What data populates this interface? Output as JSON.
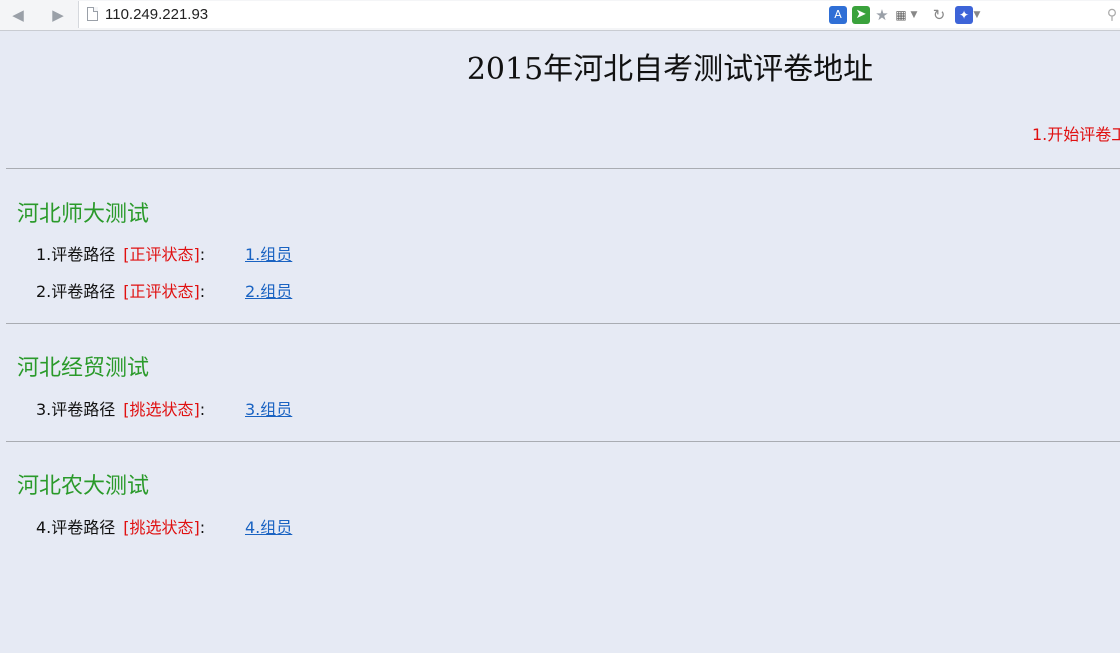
{
  "browser": {
    "url": "110.249.221.93",
    "icons": {
      "back": "back-arrow-icon",
      "forward": "forward-arrow-icon",
      "translate": "translate-icon",
      "send": "send-icon",
      "bookmark": "star-icon",
      "qr": "qr-code-icon",
      "refresh": "refresh-icon",
      "baidu": "paw-icon",
      "search": "search-icon"
    }
  },
  "page": {
    "title": "2015年河北自考测试评卷地址",
    "start_link": "1.开始评卷工",
    "sections": [
      {
        "title": "河北师大测试",
        "rows": [
          {
            "label": "1.评卷路径",
            "status": "[正评状态]",
            "colon": ":",
            "link": "1.组员"
          },
          {
            "label": "2.评卷路径",
            "status": "[正评状态]",
            "colon": ":",
            "link": "2.组员"
          }
        ]
      },
      {
        "title": "河北经贸测试",
        "rows": [
          {
            "label": "3.评卷路径",
            "status": "[挑选状态]",
            "colon": ":",
            "link": "3.组员"
          }
        ]
      },
      {
        "title": "河北农大测试",
        "rows": [
          {
            "label": "4.评卷路径",
            "status": "[挑选状态]",
            "colon": ":",
            "link": "4.组员"
          }
        ]
      }
    ]
  },
  "colors": {
    "background": "#e6eaf4",
    "section_title": "#2a9a2a",
    "status_red": "#e01010",
    "link_blue": "#1a63c2"
  }
}
